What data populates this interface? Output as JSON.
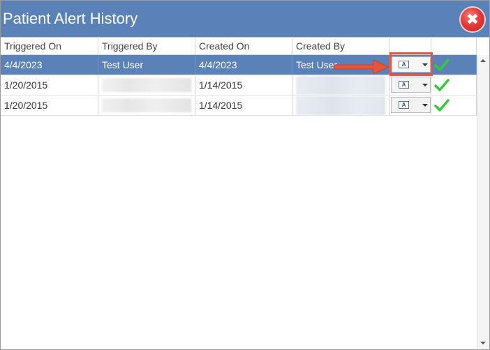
{
  "window": {
    "title": "Patient Alert History",
    "close_icon": "close-icon",
    "close_symbol": "✖"
  },
  "grid": {
    "columns": [
      "Triggered On",
      "Triggered By",
      "Created On",
      "Created By",
      "",
      ""
    ],
    "rows": [
      {
        "triggered_on": "4/4/2023",
        "triggered_by": "Test User",
        "created_on": "4/4/2023",
        "created_by": "Test User",
        "action_icon": "document-icon",
        "status_icon": "checkmark-icon",
        "selected": true
      },
      {
        "triggered_on": "1/20/2015",
        "triggered_by": "",
        "created_on": "1/14/2015",
        "created_by": "",
        "action_icon": "document-icon",
        "status_icon": "checkmark-icon",
        "selected": false
      },
      {
        "triggered_on": "1/20/2015",
        "triggered_by": "",
        "created_on": "1/14/2015",
        "created_by": "",
        "action_icon": "document-icon",
        "status_icon": "checkmark-icon",
        "selected": false
      }
    ]
  },
  "colors": {
    "title_bar": "#5a82b8",
    "selected_row": "#5a82b8",
    "highlight": "#e7553f",
    "check": "#34c93b"
  }
}
